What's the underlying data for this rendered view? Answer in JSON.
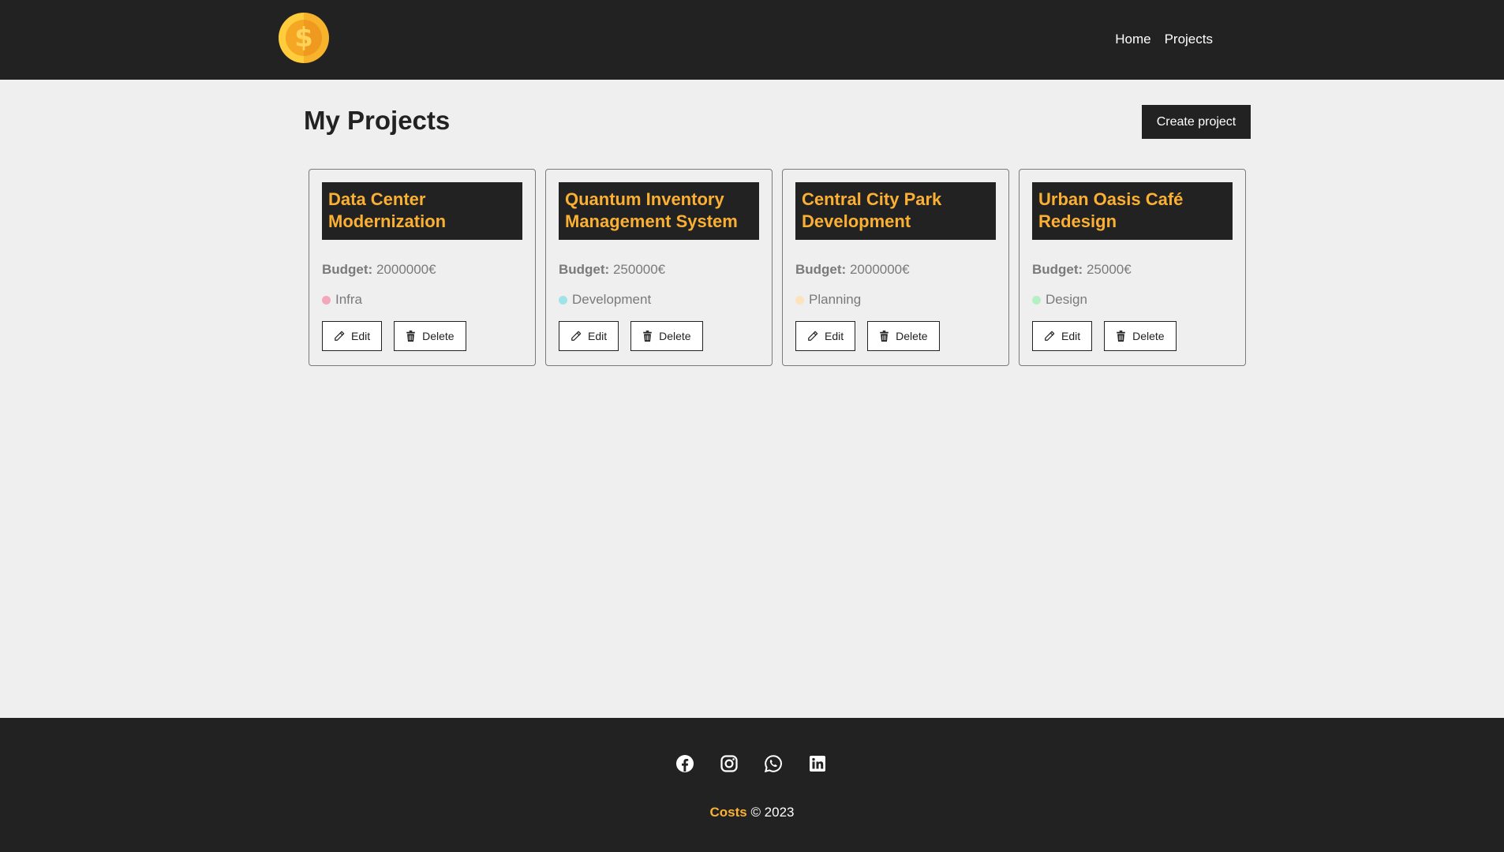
{
  "nav": {
    "links": [
      {
        "label": "Home"
      },
      {
        "label": "Projects"
      }
    ]
  },
  "main": {
    "title": "My Projects",
    "create_label": "Create project",
    "budget_label": "Budget:",
    "projects": [
      {
        "name": "Data Center Modernization",
        "budget": "2000000€",
        "category": "Infra",
        "category_color": "#f4a7b9"
      },
      {
        "name": "Quantum Inventory Management System",
        "budget": "250000€",
        "category": "Development",
        "category_color": "#9ee3e8"
      },
      {
        "name": "Central City Park Development",
        "budget": "2000000€",
        "category": "Planning",
        "category_color": "#fde2bd"
      },
      {
        "name": "Urban Oasis Café Redesign",
        "budget": "25000€",
        "category": "Design",
        "category_color": "#b4f0c4"
      }
    ],
    "edit_label": "Edit",
    "delete_label": "Delete"
  },
  "footer": {
    "icons": [
      "facebook-icon",
      "instagram-icon",
      "whatsapp-icon",
      "linkedin-icon"
    ],
    "brand": "Costs",
    "copyright": "© 2023"
  },
  "colors": {
    "dark": "#222222",
    "accent": "#fbb034",
    "background": "#efefef"
  }
}
